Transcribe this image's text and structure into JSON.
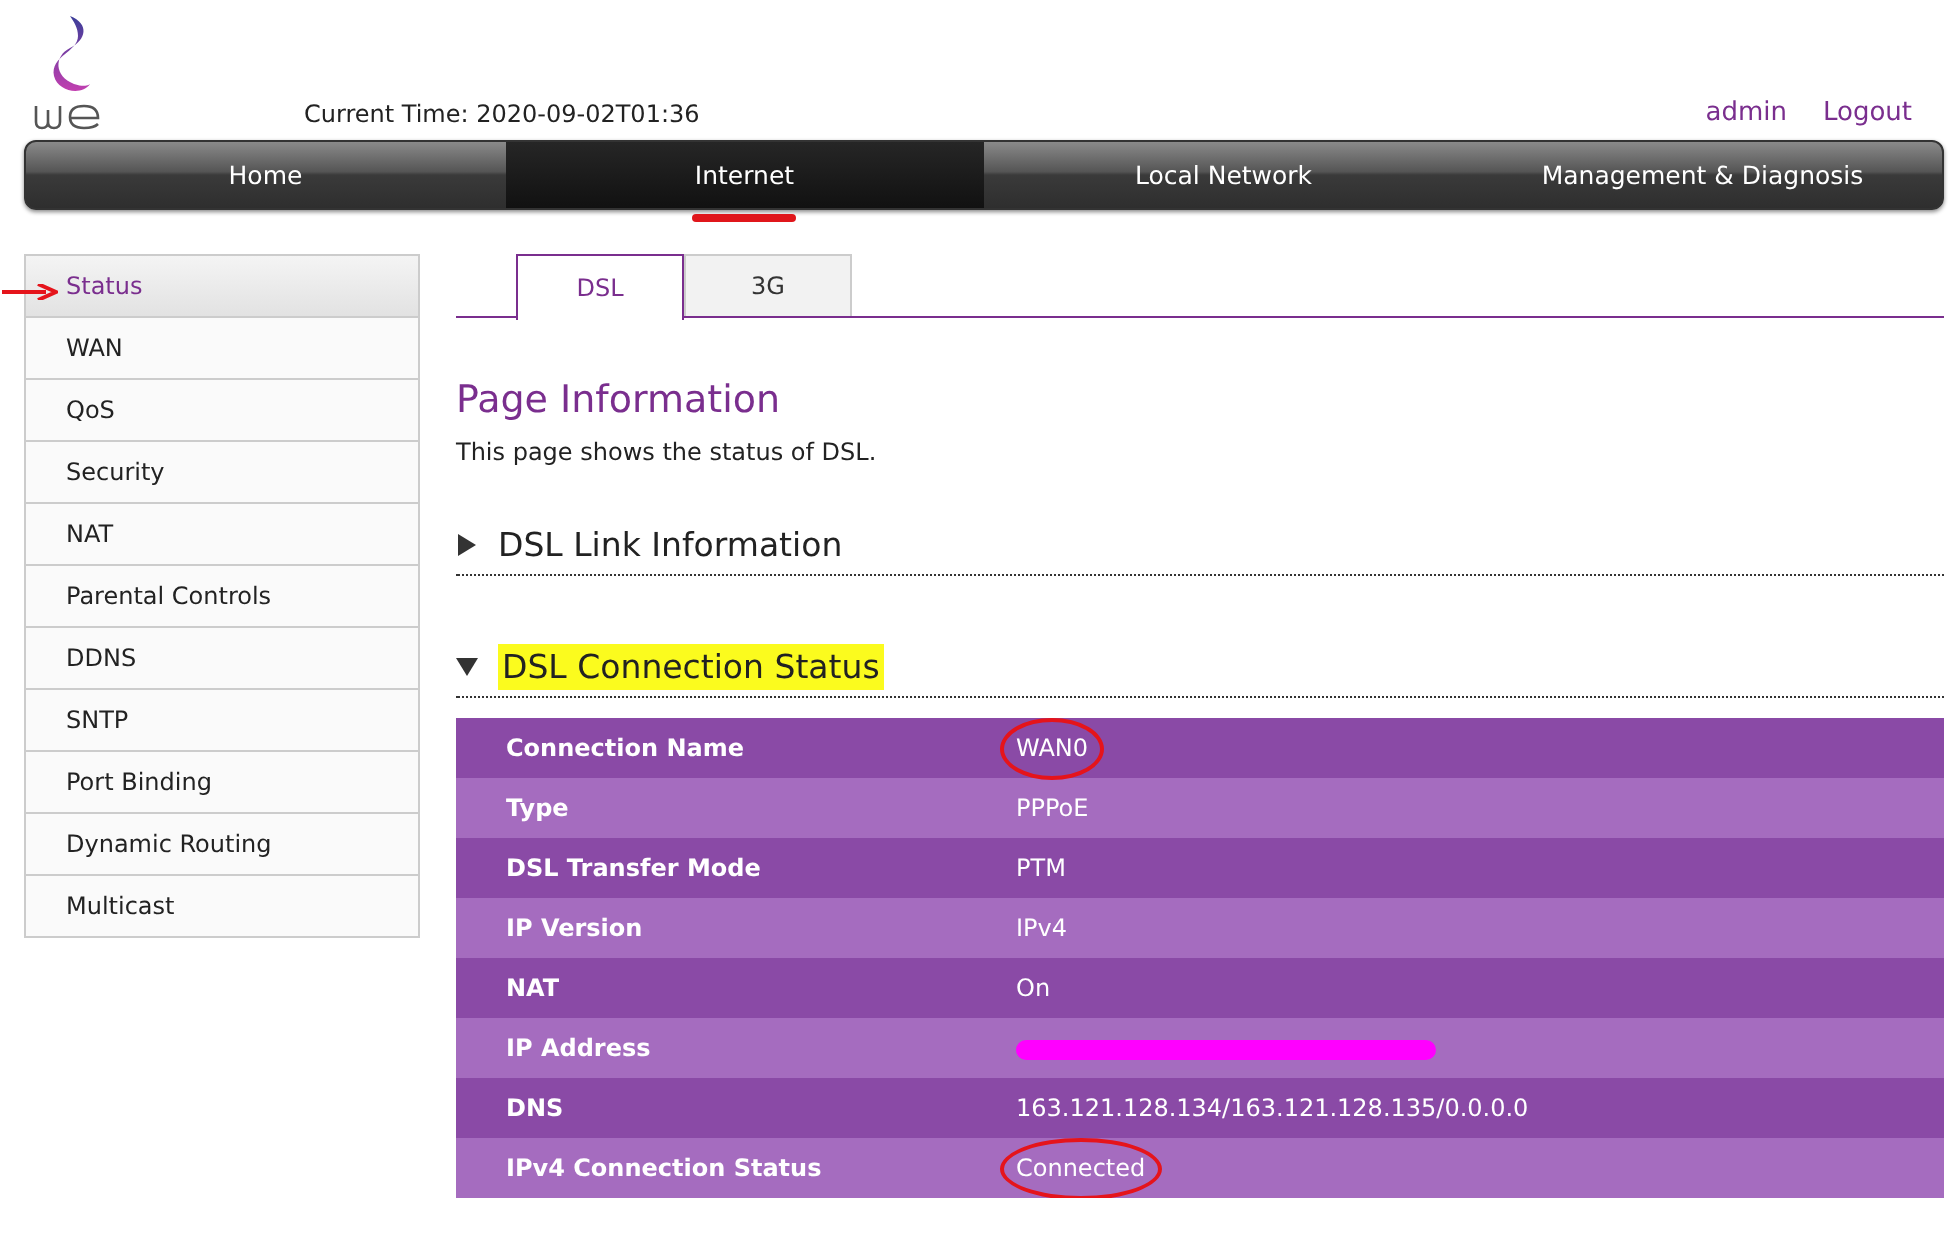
{
  "header": {
    "current_time": "Current Time: 2020-09-02T01:36",
    "user": "admin",
    "logout": "Logout"
  },
  "nav": [
    {
      "label": "Home",
      "selected": false,
      "underlined": false
    },
    {
      "label": "Internet",
      "selected": true,
      "underlined": true
    },
    {
      "label": "Local Network",
      "selected": false,
      "underlined": false
    },
    {
      "label": "Management & Diagnosis",
      "selected": false,
      "underlined": false
    }
  ],
  "sidebar": {
    "items": [
      {
        "label": "Status",
        "selected": true,
        "arrow": true
      },
      {
        "label": "WAN",
        "selected": false,
        "arrow": false
      },
      {
        "label": "QoS",
        "selected": false,
        "arrow": false
      },
      {
        "label": "Security",
        "selected": false,
        "arrow": false
      },
      {
        "label": "NAT",
        "selected": false,
        "arrow": false
      },
      {
        "label": "Parental Controls",
        "selected": false,
        "arrow": false
      },
      {
        "label": "DDNS",
        "selected": false,
        "arrow": false
      },
      {
        "label": "SNTP",
        "selected": false,
        "arrow": false
      },
      {
        "label": "Port Binding",
        "selected": false,
        "arrow": false
      },
      {
        "label": "Dynamic Routing",
        "selected": false,
        "arrow": false
      },
      {
        "label": "Multicast",
        "selected": false,
        "arrow": false
      }
    ]
  },
  "tabs": [
    {
      "label": "DSL",
      "selected": true
    },
    {
      "label": "3G",
      "selected": false
    }
  ],
  "page_info": {
    "title": "Page Information",
    "description": "This page shows the status of DSL."
  },
  "sections": [
    {
      "title": "DSL Link Information",
      "expanded": false,
      "highlighted": false
    },
    {
      "title": "DSL Connection Status",
      "expanded": true,
      "highlighted": true
    }
  ],
  "table": {
    "rows": [
      {
        "label": "Connection Name",
        "kind": "text",
        "value": "WAN0",
        "circled": true
      },
      {
        "label": "Type",
        "kind": "text",
        "value": "PPPoE",
        "circled": false
      },
      {
        "label": "DSL Transfer Mode",
        "kind": "text",
        "value": "PTM",
        "circled": false
      },
      {
        "label": "IP Version",
        "kind": "text",
        "value": "IPv4",
        "circled": false
      },
      {
        "label": "NAT",
        "kind": "text",
        "value": "On",
        "circled": false
      },
      {
        "label": "IP Address",
        "kind": "redacted"
      },
      {
        "label": "DNS",
        "kind": "text",
        "value": "163.121.128.134/163.121.128.135/0.0.0.0",
        "circled": false
      },
      {
        "label": "IPv4 Connection Status",
        "kind": "text",
        "value": "Connected",
        "circled": true
      }
    ]
  }
}
